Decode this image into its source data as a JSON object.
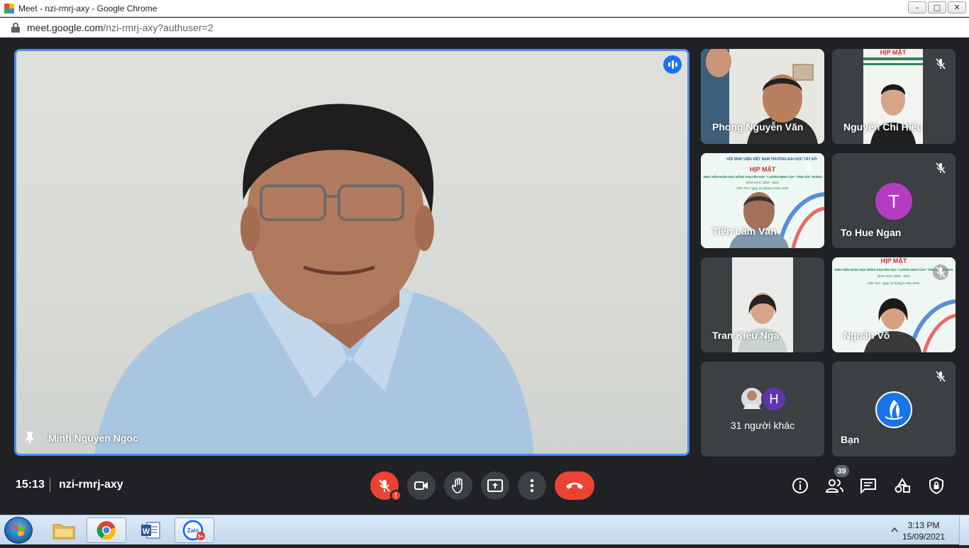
{
  "window": {
    "title": "Meet - nzi-rmrj-axy - Google Chrome",
    "url_host": "meet.google.com",
    "url_path": "/nzi-rmrj-axy?authuser=2",
    "controls": [
      "–",
      "□",
      "✕"
    ]
  },
  "main_speaker": {
    "name": "Minh Nguyen Ngoc"
  },
  "tiles": [
    {
      "name": "Phong Nguyễn Văn",
      "muted": false
    },
    {
      "name": "Nguyên Chí Hiếu",
      "muted": true
    },
    {
      "name": "Tiến Lâm Văn",
      "muted": true
    },
    {
      "name": "To Hue Ngan",
      "muted": true,
      "avatar_letter": "T",
      "avatar_color": "#b43cc2"
    },
    {
      "name": "Tran Kieu Nga",
      "muted": false
    },
    {
      "name": "Ngoãn Võ",
      "muted": true
    },
    {
      "name": "31 người khác",
      "avatar_letter": "H",
      "avatar_color": "#5e35b1"
    },
    {
      "name": "Bạn",
      "muted": true
    }
  ],
  "banners": {
    "hop_mat": "HỊP MẶT",
    "line1": "HỘI SINH VIÊN VIỆT NAM TRƯỜNG ĐẠI HỌC TÂY ĐÔ",
    "line2": "SINH VIÊN NHẬN HỌC BỔNG KHUYẾN HỌC \"LƯƠNG ĐỊNH CỦA\" TỈNH SÓC TRĂNG",
    "line3": "NĂM HỌC 2020 - 2021",
    "line4": "Cần Thơ, ngày 15 tháng 9 năm 2021"
  },
  "bottombar": {
    "time": "15:13",
    "meeting_code": "nzi-rmrj-axy",
    "participants_count": "39"
  },
  "taskbar": {
    "time": "3:13 PM",
    "date": "15/09/2021",
    "zalo_label": "Zalo",
    "zalo_badge": "5+"
  },
  "colors": {
    "accent_blue": "#1a73e8",
    "end_call_red": "#ea4335",
    "tile_bg": "#3c4043",
    "page_bg": "#202124"
  }
}
